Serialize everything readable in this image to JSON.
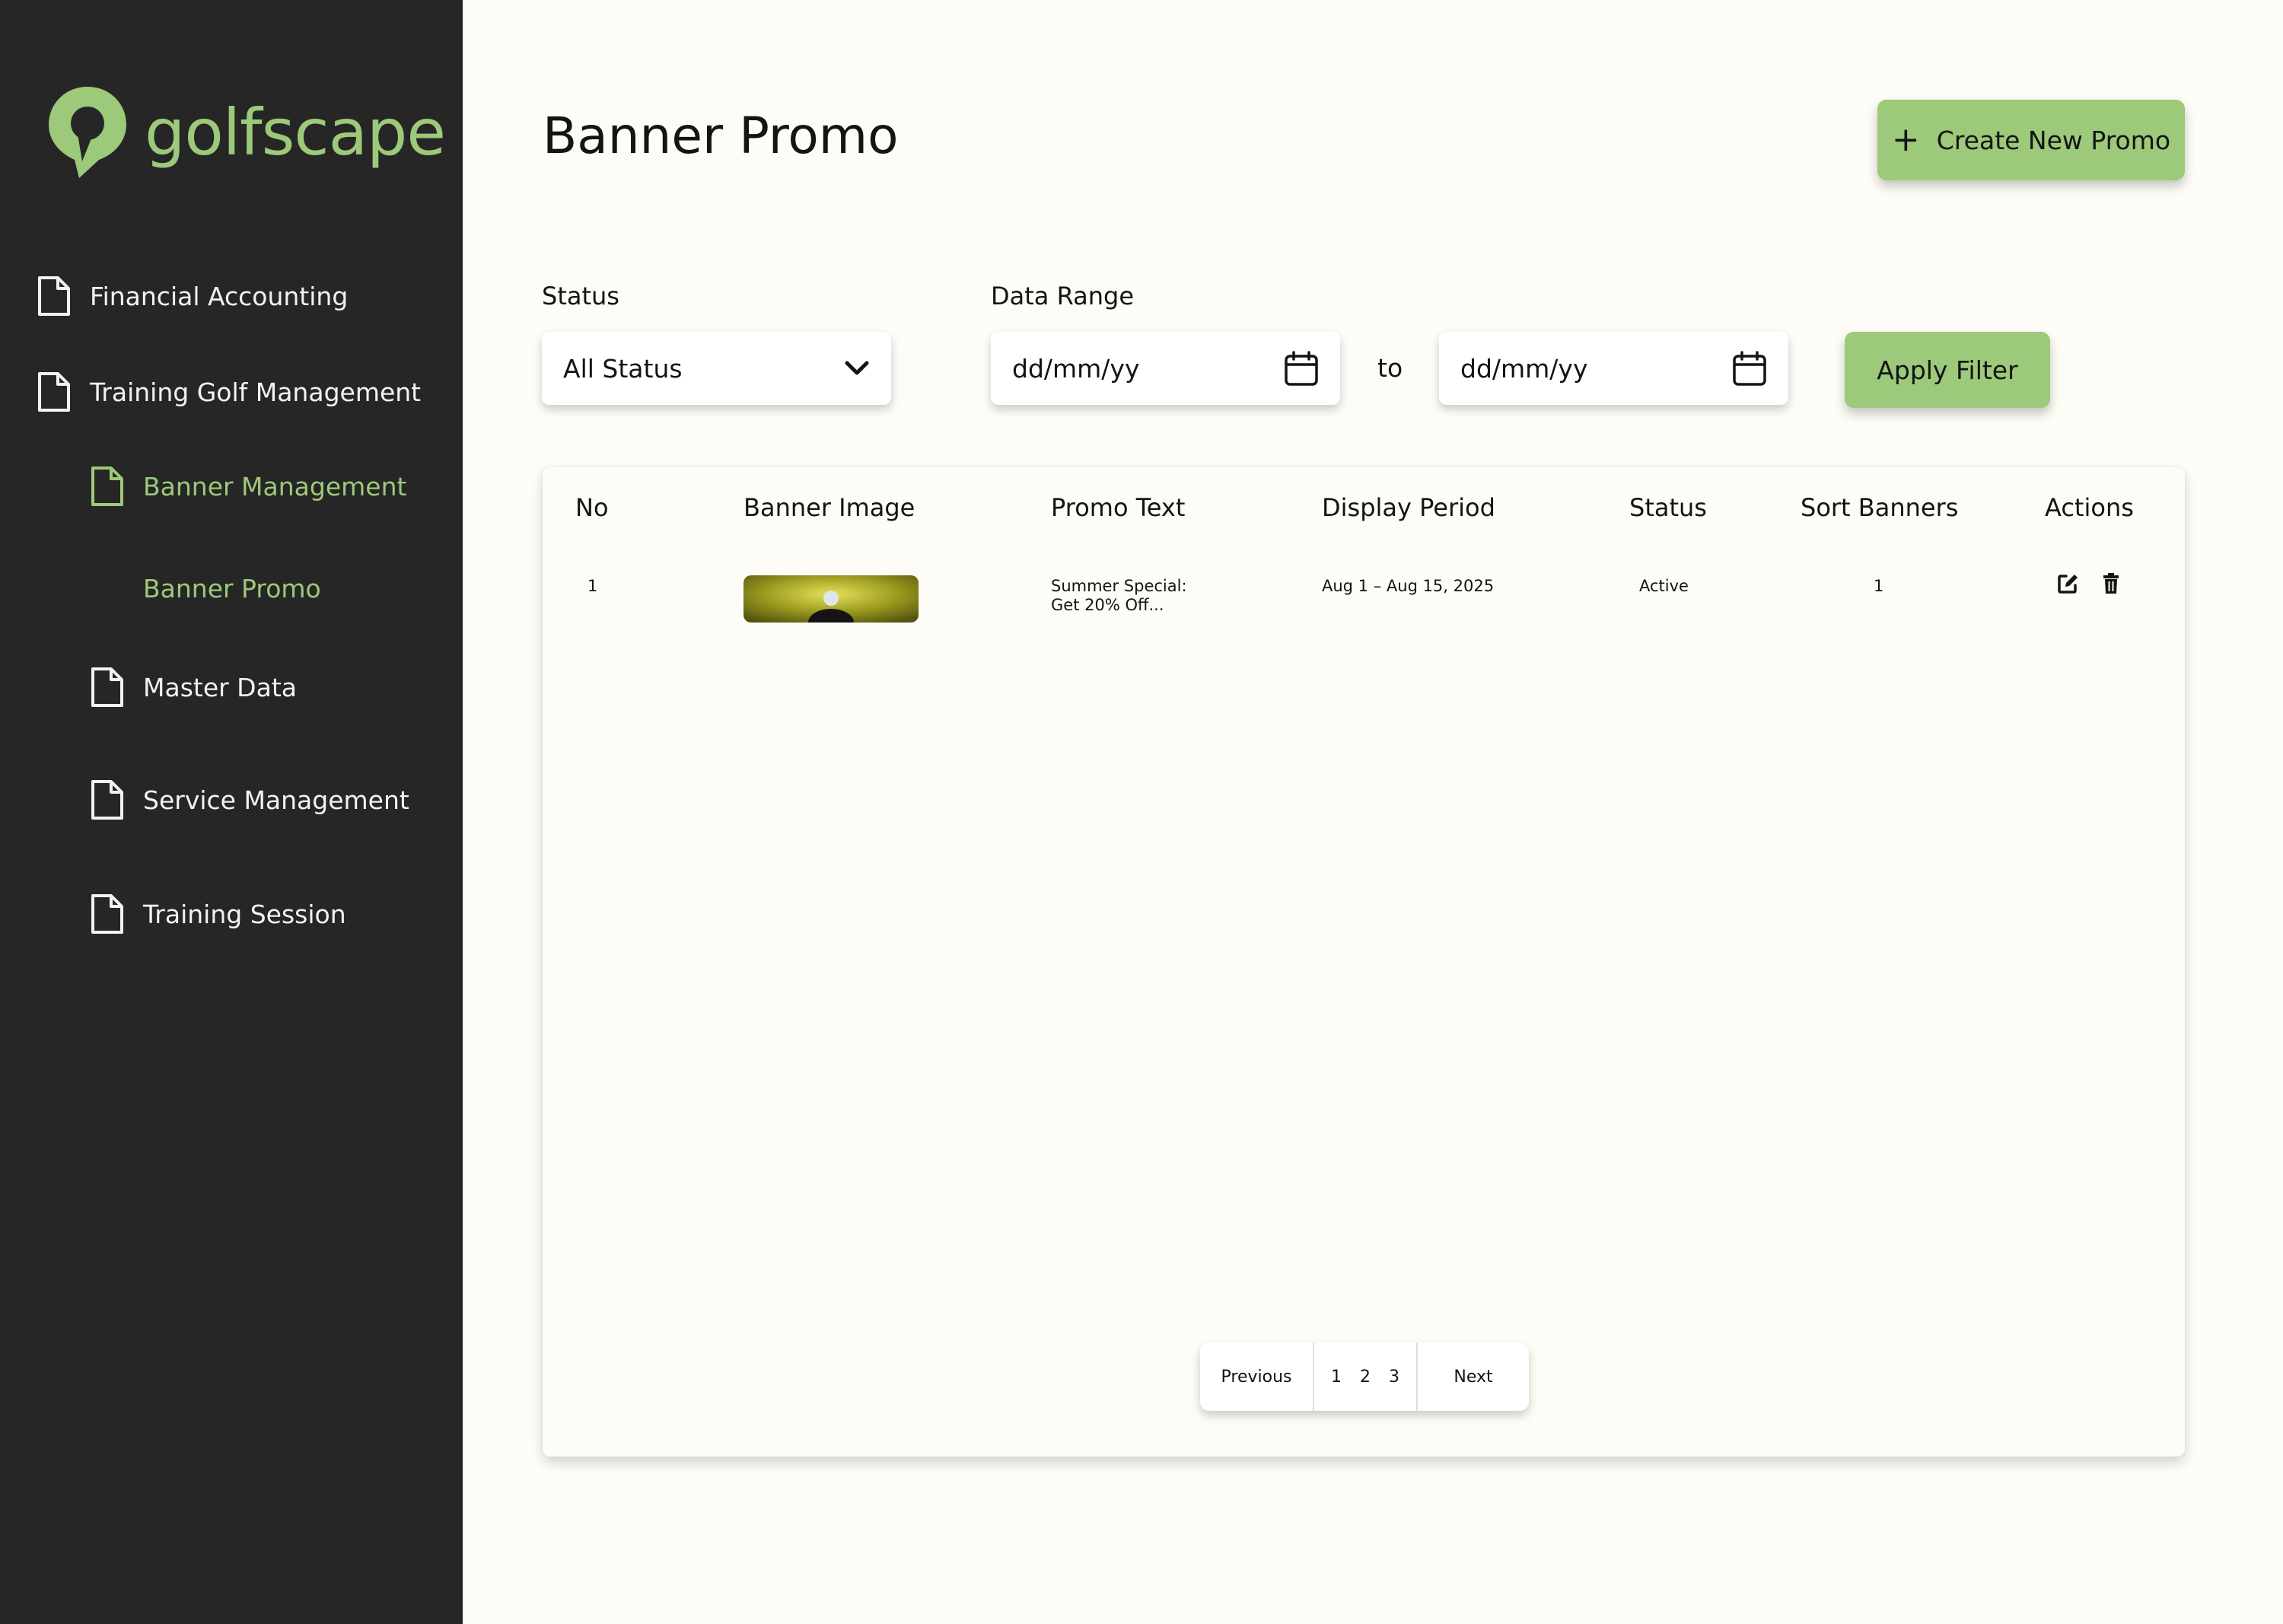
{
  "brand": {
    "name": "golfscape",
    "accent": "#9cc97a",
    "sidebar_bg": "#262626"
  },
  "sidebar": {
    "items": [
      {
        "label": "Financial Accounting",
        "icon": "document-icon"
      },
      {
        "label": "Training Golf Management",
        "icon": "document-icon"
      },
      {
        "label": "Banner Management",
        "icon": "document-icon",
        "active": true
      },
      {
        "label": "Banner Promo",
        "sub": true
      },
      {
        "label": "Master Data",
        "icon": "document-icon"
      },
      {
        "label": "Service Management",
        "icon": "document-icon"
      },
      {
        "label": "Training Session",
        "icon": "document-icon"
      }
    ]
  },
  "header": {
    "title": "Banner Promo",
    "create_label": "Create New Promo"
  },
  "filters": {
    "status_label": "Status",
    "status_value": "All Status",
    "range_label": "Data Range",
    "from_placeholder": "dd/mm/yy",
    "to_label": "to",
    "to_placeholder": "dd/mm/yy",
    "apply_label": "Apply Filter"
  },
  "table": {
    "columns": [
      "No",
      "Banner Image",
      "Promo Text",
      "Display Period",
      "Status",
      "Sort Banners",
      "Actions"
    ],
    "rows": [
      {
        "no": "1",
        "promo_text_line1": "Summer Special:",
        "promo_text_line2": "Get 20% Off...",
        "display_period": "Aug 1 – Aug 15, 2025",
        "status": "Active",
        "sort": "1"
      }
    ]
  },
  "pagination": {
    "prev": "Previous",
    "pages": [
      "1",
      "2",
      "3"
    ],
    "next": "Next"
  }
}
